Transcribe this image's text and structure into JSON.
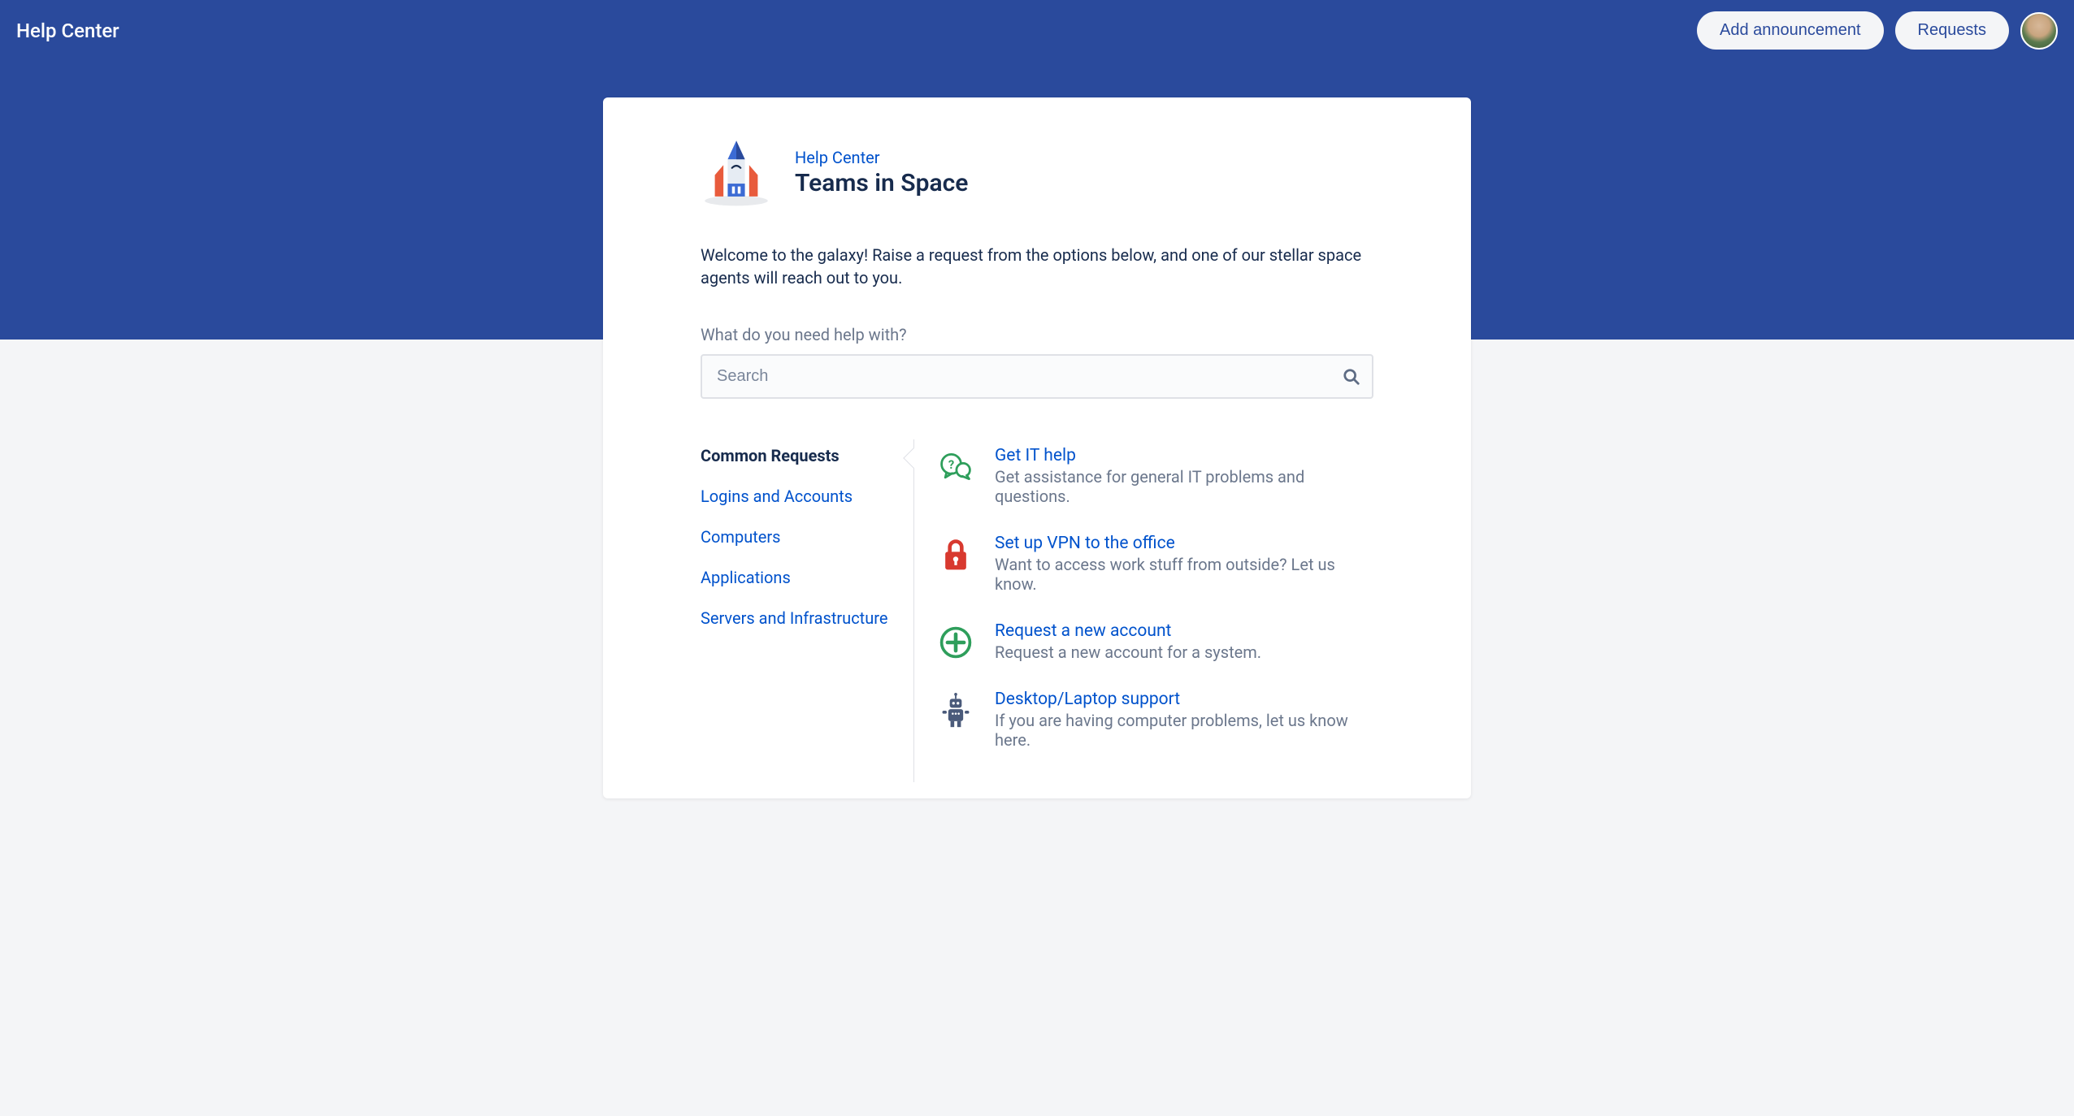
{
  "topbar": {
    "title": "Help Center",
    "add_announcement": "Add announcement",
    "requests": "Requests"
  },
  "breadcrumb": {
    "link_label": "Help Center",
    "project_title": "Teams in Space"
  },
  "welcome_text": "Welcome to the galaxy! Raise a request from the options below, and one of our stellar space agents will reach out to you.",
  "search": {
    "label": "What do you need help with?",
    "placeholder": "Search"
  },
  "categories": [
    {
      "label": "Common Requests",
      "active": true
    },
    {
      "label": "Logins and Accounts",
      "active": false
    },
    {
      "label": "Computers",
      "active": false
    },
    {
      "label": "Applications",
      "active": false
    },
    {
      "label": "Servers and Infrastructure",
      "active": false
    }
  ],
  "requests": [
    {
      "icon": "chat-icon",
      "title": "Get IT help",
      "desc": "Get assistance for general IT problems and questions."
    },
    {
      "icon": "lock-icon",
      "title": "Set up VPN to the office",
      "desc": "Want to access work stuff from outside? Let us know."
    },
    {
      "icon": "plus-icon",
      "title": "Request a new account",
      "desc": "Request a new account for a system."
    },
    {
      "icon": "robot-icon",
      "title": "Desktop/Laptop support",
      "desc": "If you are having computer problems, let us know here."
    }
  ],
  "colors": {
    "brand_blue": "#2a4a9c",
    "link_blue": "#0052cc",
    "text_dark": "#172b4d",
    "text_muted": "#6b778c",
    "border": "#dfe1e6",
    "bg_soft": "#f4f5f7"
  }
}
